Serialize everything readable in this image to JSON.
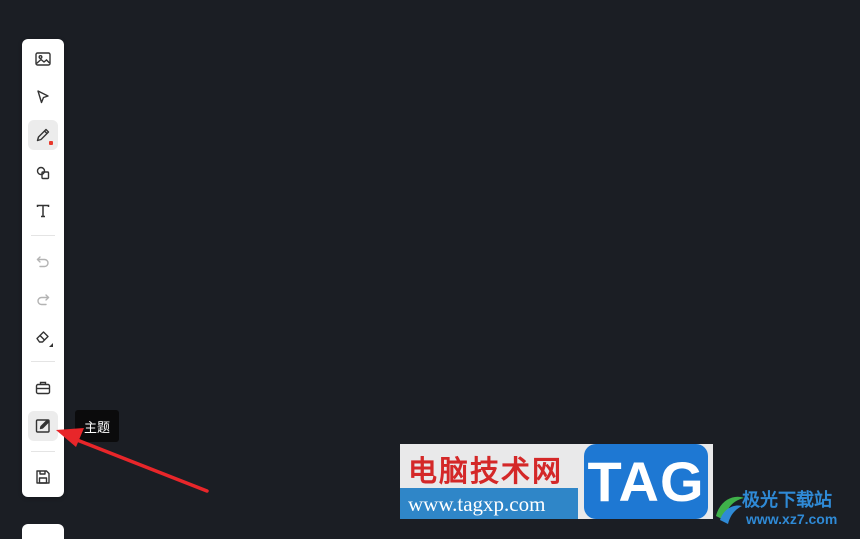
{
  "toolbar": {
    "tools": [
      {
        "name": "image-icon"
      },
      {
        "name": "select-cursor-icon"
      },
      {
        "name": "pen-icon",
        "active": true
      },
      {
        "name": "shapes-icon"
      },
      {
        "name": "text-icon"
      },
      {
        "name": "undo-icon",
        "disabled": true
      },
      {
        "name": "redo-icon",
        "disabled": true
      },
      {
        "name": "eraser-icon"
      },
      {
        "name": "toolbox-icon"
      },
      {
        "name": "theme-icon",
        "active": true
      },
      {
        "name": "save-icon"
      }
    ]
  },
  "tooltip": {
    "text": "主题"
  },
  "watermark": {
    "title": "电脑技术网",
    "url": "www.tagxp.com",
    "tag": "TAG"
  },
  "site_logo": {
    "name": "极光下载站",
    "url": "www.xz7.com"
  },
  "colors": {
    "canvas_bg": "#1b1e24",
    "toolbar_bg": "#ffffff",
    "arrow": "#e8262a",
    "tooltip_bg": "#0b0b0c",
    "pen_dot": "#e8392c"
  }
}
